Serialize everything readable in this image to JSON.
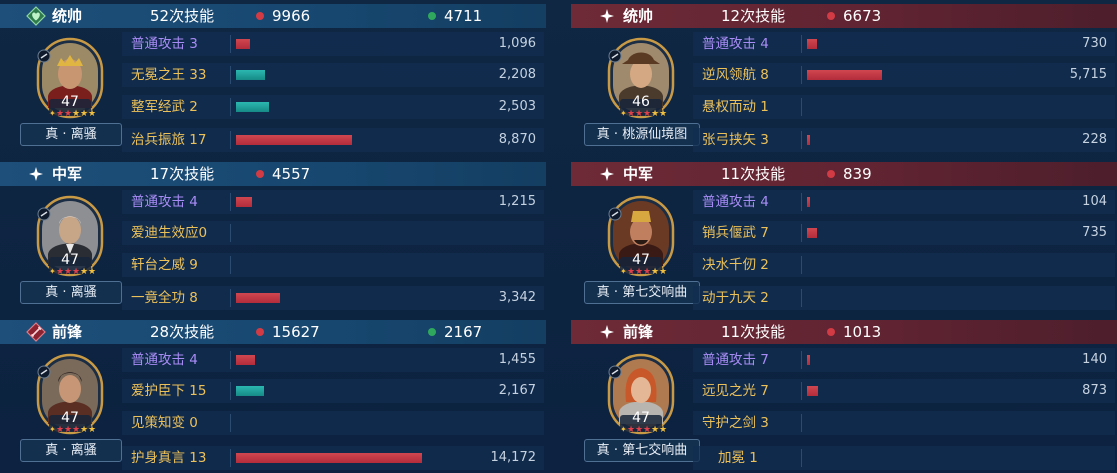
{
  "colors": {
    "damage_dot": "#d23b44",
    "heal_dot": "#2fa85d",
    "normal_attack_text": "#a88cf5",
    "skill_text": "#ecc15a",
    "bar_red": "#c73b47",
    "bar_teal": "#22a39d",
    "left_header": "#1d4f7a",
    "right_header": "#6e2a37"
  },
  "bar_scale_max": 14172,
  "left": {
    "sections": [
      {
        "role": "统帅",
        "emblem_icon": "commander-heart-emblem-icon",
        "skill_count": "52次技能",
        "damage": "9966",
        "heal": "4711",
        "general": {
          "name": "真 · 离骚",
          "level": "47",
          "stars": 5,
          "red_stars": 2
        },
        "skills": [
          {
            "name": "普通攻击",
            "uses": "3",
            "value": "1,096",
            "amount": 1096,
            "bar": "red",
            "kind": "normal"
          },
          {
            "name": "无冕之王",
            "uses": "33",
            "value": "2,208",
            "amount": 2208,
            "bar": "teal",
            "kind": "skill"
          },
          {
            "name": "整军经武",
            "uses": "2",
            "value": "2,503",
            "amount": 2503,
            "bar": "teal",
            "kind": "skill"
          },
          {
            "name": "治兵振旅",
            "uses": "17",
            "value": "8,870",
            "amount": 8870,
            "bar": "red",
            "kind": "skill"
          }
        ]
      },
      {
        "role": "中军",
        "emblem_icon": "sparkle-icon",
        "skill_count": "17次技能",
        "damage": "4557",
        "heal": "",
        "general": {
          "name": "真 · 离骚",
          "level": "47",
          "stars": 5,
          "red_stars": 3
        },
        "skills": [
          {
            "name": "普通攻击",
            "uses": "4",
            "value": "1,215",
            "amount": 1215,
            "bar": "red",
            "kind": "normal"
          },
          {
            "name": "爱迪生效应",
            "uses": "0",
            "value": "",
            "amount": 0,
            "bar": "red",
            "kind": "skill"
          },
          {
            "name": "轩台之威",
            "uses": "9",
            "value": "",
            "amount": 0,
            "bar": "red",
            "kind": "skill"
          },
          {
            "name": "一竟全功",
            "uses": "8",
            "value": "3,342",
            "amount": 3342,
            "bar": "red",
            "kind": "skill"
          }
        ]
      },
      {
        "role": "前锋",
        "emblem_icon": "vanguard-sword-emblem-icon",
        "skill_count": "28次技能",
        "damage": "15627",
        "heal": "2167",
        "general": {
          "name": "真 · 离骚",
          "level": "47",
          "stars": 5,
          "red_stars": 3
        },
        "skills": [
          {
            "name": "普通攻击",
            "uses": "4",
            "value": "1,455",
            "amount": 1455,
            "bar": "red",
            "kind": "normal"
          },
          {
            "name": "爱护臣下",
            "uses": "15",
            "value": "2,167",
            "amount": 2167,
            "bar": "teal",
            "kind": "skill"
          },
          {
            "name": "见策知变",
            "uses": "0",
            "value": "",
            "amount": 0,
            "bar": "red",
            "kind": "skill"
          },
          {
            "name": "护身真言",
            "uses": "13",
            "value": "14,172",
            "amount": 14172,
            "bar": "red",
            "kind": "skill"
          }
        ]
      }
    ]
  },
  "right": {
    "sections": [
      {
        "role": "统帅",
        "emblem_icon": "sparkle-icon",
        "skill_count": "12次技能",
        "damage": "6673",
        "heal": "",
        "general": {
          "name": "真 · 桃源仙境图",
          "level": "46",
          "stars": 5,
          "red_stars": 3
        },
        "skills": [
          {
            "name": "普通攻击",
            "uses": "4",
            "value": "730",
            "amount": 730,
            "bar": "red",
            "kind": "normal"
          },
          {
            "name": "逆风领航",
            "uses": "8",
            "value": "5,715",
            "amount": 5715,
            "bar": "red",
            "kind": "skill"
          },
          {
            "name": "悬权而动",
            "uses": "1",
            "value": "",
            "amount": 0,
            "bar": "red",
            "kind": "skill"
          },
          {
            "name": "张弓挟矢",
            "uses": "3",
            "value": "228",
            "amount": 228,
            "bar": "red",
            "kind": "skill"
          }
        ]
      },
      {
        "role": "中军",
        "emblem_icon": "sparkle-icon",
        "skill_count": "11次技能",
        "damage": "839",
        "heal": "",
        "general": {
          "name": "真 · 第七交响曲",
          "level": "47",
          "stars": 5,
          "red_stars": 3
        },
        "skills": [
          {
            "name": "普通攻击",
            "uses": "4",
            "value": "104",
            "amount": 104,
            "bar": "red",
            "kind": "normal"
          },
          {
            "name": "销兵偃武",
            "uses": "7",
            "value": "735",
            "amount": 735,
            "bar": "red",
            "kind": "skill"
          },
          {
            "name": "决水千仞",
            "uses": "2",
            "value": "",
            "amount": 0,
            "bar": "red",
            "kind": "skill"
          },
          {
            "name": "动于九天",
            "uses": "2",
            "value": "",
            "amount": 0,
            "bar": "red",
            "kind": "skill"
          }
        ]
      },
      {
        "role": "前锋",
        "emblem_icon": "sparkle-icon",
        "skill_count": "11次技能",
        "damage": "1013",
        "heal": "",
        "general": {
          "name": "真 · 第七交响曲",
          "level": "47",
          "stars": 5,
          "red_stars": 3
        },
        "skills": [
          {
            "name": "普通攻击",
            "uses": "7",
            "value": "140",
            "amount": 140,
            "bar": "red",
            "kind": "normal"
          },
          {
            "name": "远见之光",
            "uses": "7",
            "value": "873",
            "amount": 873,
            "bar": "red",
            "kind": "skill"
          },
          {
            "name": "守护之剑",
            "uses": "3",
            "value": "",
            "amount": 0,
            "bar": "red",
            "kind": "skill"
          },
          {
            "name": "加冕",
            "uses": "1",
            "value": "",
            "amount": 0,
            "bar": "red",
            "kind": "skill"
          }
        ]
      }
    ]
  }
}
